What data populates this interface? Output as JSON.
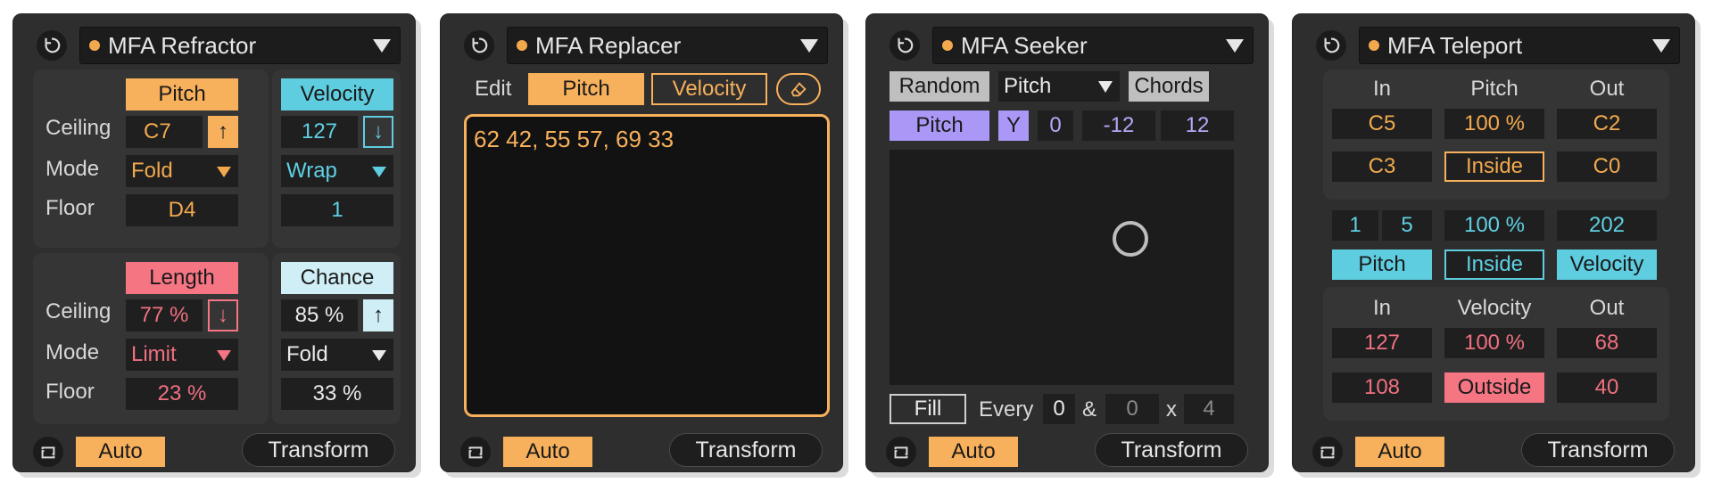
{
  "colors": {
    "orange": "#f7b05b",
    "cyan": "#5fcde0",
    "pink": "#f57583",
    "light_cyan": "#cfeef5",
    "purple": "#ab98f6",
    "device_bg": "#2e2e2e"
  },
  "icons": {
    "header": "power-cycle-icon",
    "footer": "loop-icon",
    "dropdown": "chevron-down-icon",
    "eraser": "eraser-icon",
    "arrow_up": "arrow-up-icon",
    "arrow_down": "arrow-down-icon"
  },
  "footer": {
    "auto_label": "Auto",
    "transform_label": "Transform"
  },
  "refractor": {
    "title": "MFA Refractor",
    "pitch": {
      "header": "Pitch",
      "ceiling": "C7",
      "mode": "Fold",
      "floor": "D4",
      "direction": "↑"
    },
    "velocity": {
      "header": "Velocity",
      "ceiling": "127",
      "mode": "Wrap",
      "floor": "1",
      "direction": "↓"
    },
    "length": {
      "header": "Length",
      "ceiling": "77 %",
      "mode": "Limit",
      "floor": "23 %",
      "direction": "↓"
    },
    "chance": {
      "header": "Chance",
      "ceiling": "85 %",
      "mode": "Fold",
      "floor": "33 %",
      "direction": "↑"
    },
    "row_labels": {
      "ceiling": "Ceiling",
      "mode": "Mode",
      "floor": "Floor"
    }
  },
  "replacer": {
    "title": "MFA Replacer",
    "edit_label": "Edit",
    "pitch_label": "Pitch",
    "velocity_label": "Velocity",
    "text": "62 42, 55 57, 69 33"
  },
  "seeker": {
    "title": "MFA Seeker",
    "random_label": "Random",
    "target_select": "Pitch",
    "chords_label": "Chords",
    "axis_param": "Pitch",
    "axis_label": "Y",
    "axis_offset": "0",
    "axis_min": "-12",
    "axis_max": "12",
    "fill_label": "Fill",
    "every_label": "Every",
    "every_a": "0",
    "amp": "&",
    "every_b": "0",
    "x_label": "x",
    "every_c": "4"
  },
  "teleport": {
    "title": "MFA Teleport",
    "top": {
      "in_label": "In",
      "mid_label": "Pitch",
      "out_label": "Out",
      "in_high": "C5",
      "amount": "100 %",
      "out_high": "C2",
      "in_low": "C3",
      "mode": "Inside",
      "out_low": "C0"
    },
    "middle": {
      "range_a": "1",
      "range_b": "5",
      "amount": "100 %",
      "value": "202",
      "pitch_btn": "Pitch",
      "mode": "Inside",
      "velocity_btn": "Velocity"
    },
    "bottom": {
      "in_label": "In",
      "mid_label": "Velocity",
      "out_label": "Out",
      "in_high": "127",
      "amount": "100 %",
      "out_high": "68",
      "in_low": "108",
      "mode": "Outside",
      "out_low": "40"
    }
  }
}
